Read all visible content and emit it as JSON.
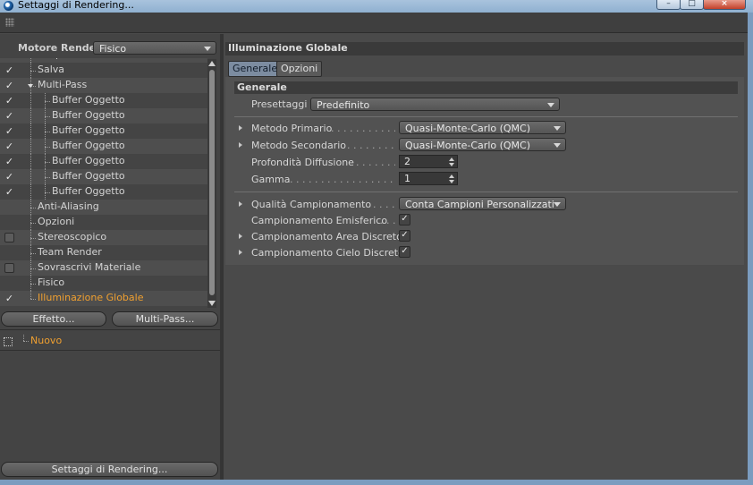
{
  "window": {
    "title": "Settaggi di Rendering...",
    "minimize": "–",
    "maximize": "□",
    "close": "×"
  },
  "left": {
    "engine_label": "Motore Render",
    "engine_value": "Fisico",
    "tree": [
      {
        "label": "Output",
        "checked": false,
        "checkbox": "none"
      },
      {
        "label": "Salva",
        "checked": true,
        "checkbox": "check"
      },
      {
        "label": "Multi-Pass",
        "checked": true,
        "checkbox": "check"
      },
      {
        "label": "Buffer Oggetto",
        "checked": true,
        "checkbox": "check"
      },
      {
        "label": "Buffer Oggetto",
        "checked": true,
        "checkbox": "check"
      },
      {
        "label": "Buffer Oggetto",
        "checked": true,
        "checkbox": "check"
      },
      {
        "label": "Buffer Oggetto",
        "checked": true,
        "checkbox": "check"
      },
      {
        "label": "Buffer Oggetto",
        "checked": true,
        "checkbox": "check"
      },
      {
        "label": "Buffer Oggetto",
        "checked": true,
        "checkbox": "check"
      },
      {
        "label": "Buffer Oggetto",
        "checked": true,
        "checkbox": "check"
      },
      {
        "label": "Anti-Aliasing",
        "checked": false,
        "checkbox": "none"
      },
      {
        "label": "Opzioni",
        "checked": false,
        "checkbox": "none"
      },
      {
        "label": "Stereoscopico",
        "checked": false,
        "checkbox": "box"
      },
      {
        "label": "Team Render",
        "checked": false,
        "checkbox": "none"
      },
      {
        "label": "Sovrascrivi Materiale",
        "checked": false,
        "checkbox": "box"
      },
      {
        "label": "Fisico",
        "checked": false,
        "checkbox": "none"
      },
      {
        "label": "Illuminazione Globale",
        "checked": true,
        "checkbox": "check",
        "selected": true
      }
    ],
    "effect_button": "Effetto...",
    "multipass_button": "Multi-Pass...",
    "preset_item": "Nuovo",
    "bottom_button": "Settaggi di Rendering..."
  },
  "right": {
    "header": "Illuminazione Globale",
    "tabs": [
      "Generale",
      "Opzioni"
    ],
    "active_tab": "Generale",
    "group_title": "Generale",
    "preset_label": "Presettaggi",
    "preset_value": "Predefinito",
    "primary_label": "Metodo Primario",
    "primary_value": "Quasi-Monte-Carlo (QMC)",
    "secondary_label": "Metodo Secondario",
    "secondary_value": "Quasi-Monte-Carlo (QMC)",
    "depth_label": "Profondità Diffusione",
    "depth_value": "2",
    "gamma_label": "Gamma",
    "gamma_value": "1",
    "quality_label": "Qualità Campionamento",
    "quality_value": "Conta Campioni Personalizzati",
    "hemi_label": "Campionamento Emisferico",
    "hemi_checked": true,
    "area_label": "Campionamento Area Discreto",
    "area_checked": true,
    "sky_label": "Campionamento Cielo Discreto",
    "sky_checked": true
  }
}
